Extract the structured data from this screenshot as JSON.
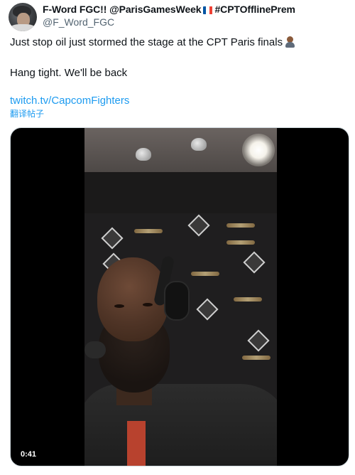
{
  "tweet": {
    "display_name": "F-Word FGC!! @ParisGamesWeek",
    "display_name_tail": "#CPTOfflinePrem",
    "handle": "@F_Word_FGC",
    "text_line1": "Just stop oil just stormed the stage at the CPT Paris finals",
    "text_line2": "Hang tight. We'll be back",
    "link": "twitch.tv/CapcomFighters",
    "translate_label": "翻译帖子"
  },
  "media": {
    "duration": "0:41"
  },
  "icons": {
    "flag": "france-flag-icon",
    "emoji": "person-facepalming-emoji-icon"
  },
  "colors": {
    "link": "#1d9bf0",
    "handle": "#536471",
    "text": "#0f1419",
    "media_bg": "#000000"
  }
}
